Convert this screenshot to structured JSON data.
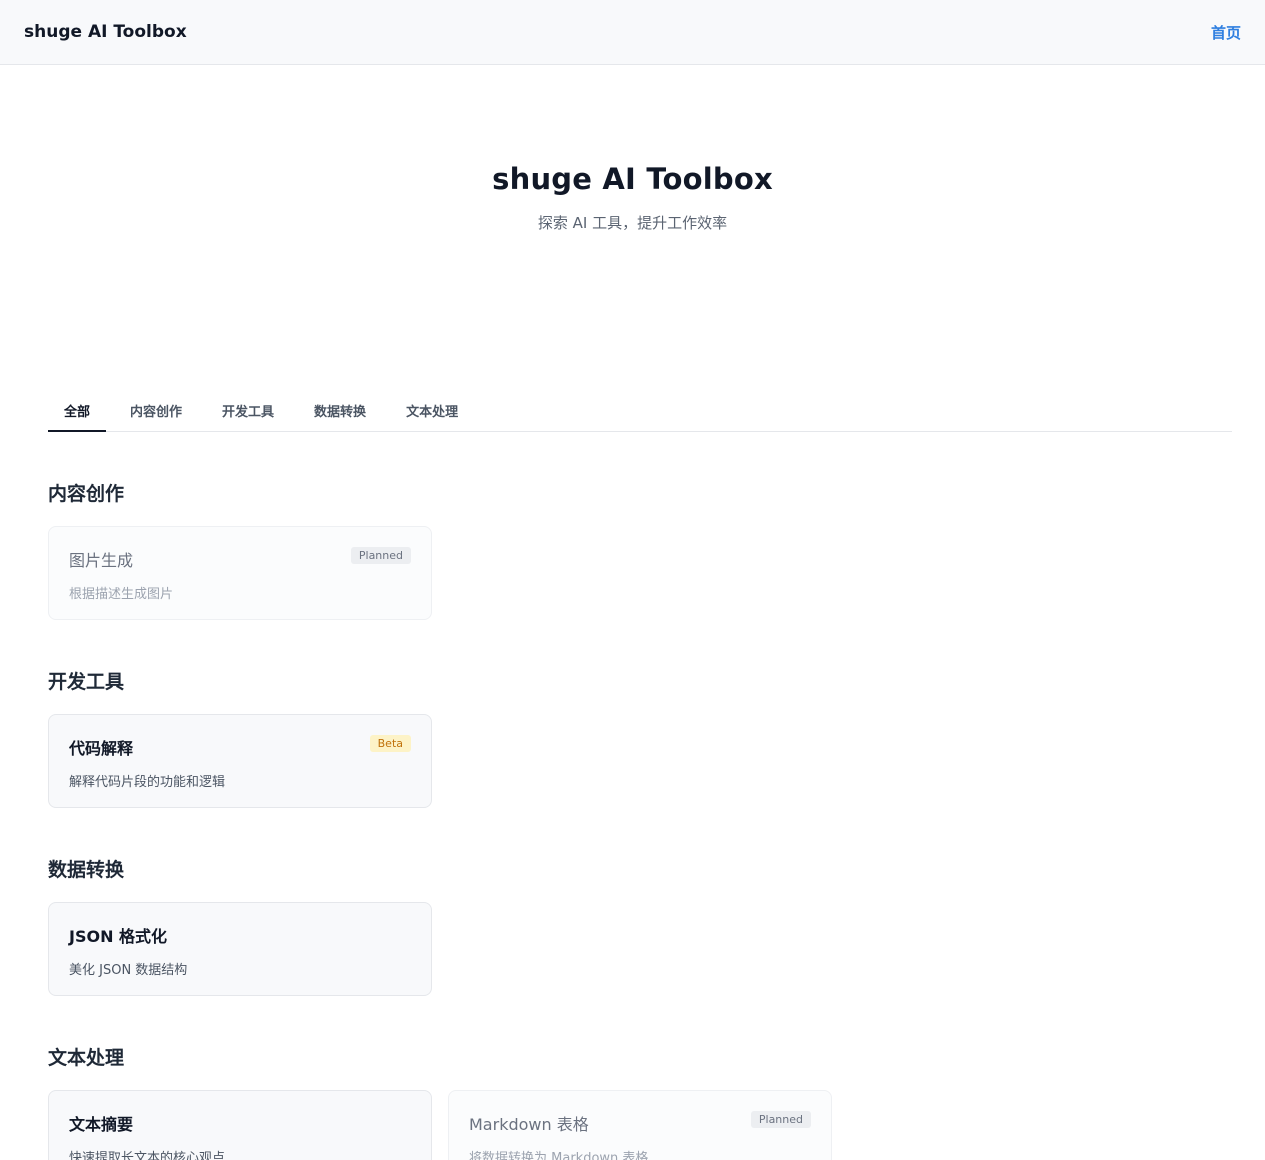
{
  "header": {
    "brand": "shuge AI Toolbox",
    "home_link": "首页"
  },
  "hero": {
    "title": "shuge AI Toolbox",
    "subtitle": "探索 AI 工具，提升工作效率"
  },
  "tabs": [
    {
      "label": "全部",
      "active": true
    },
    {
      "label": "内容创作",
      "active": false
    },
    {
      "label": "开发工具",
      "active": false
    },
    {
      "label": "数据转换",
      "active": false
    },
    {
      "label": "文本处理",
      "active": false
    }
  ],
  "sections": [
    {
      "title": "内容创作",
      "cards": [
        {
          "title": "图片生成",
          "desc": "根据描述生成图片",
          "badge": "Planned",
          "status": "planned"
        }
      ]
    },
    {
      "title": "开发工具",
      "cards": [
        {
          "title": "代码解释",
          "desc": "解释代码片段的功能和逻辑",
          "badge": "Beta",
          "status": "beta"
        }
      ]
    },
    {
      "title": "数据转换",
      "cards": [
        {
          "title": "JSON 格式化",
          "desc": "美化 JSON 数据结构",
          "badge": "",
          "status": "ready"
        }
      ]
    },
    {
      "title": "文本处理",
      "cards": [
        {
          "title": "文本摘要",
          "desc": "快速提取长文本的核心观点",
          "badge": "",
          "status": "ready"
        },
        {
          "title": "Markdown 表格",
          "desc": "将数据转换为 Markdown 表格",
          "badge": "Planned",
          "status": "planned"
        }
      ]
    }
  ]
}
